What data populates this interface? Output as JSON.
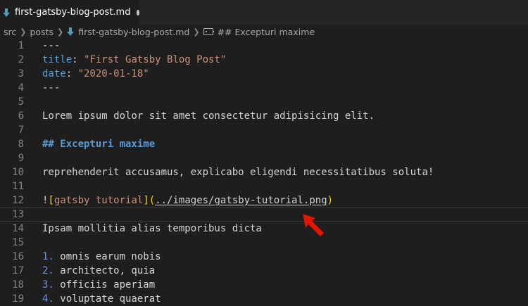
{
  "tab": {
    "icon": "markdown-file-icon",
    "label": "first-gatsby-blog-post.md"
  },
  "breadcrumb": {
    "items": [
      "src",
      "posts",
      "first-gatsby-blog-post.md",
      "## Excepturi maxime"
    ]
  },
  "editor": {
    "lines": [
      {
        "n": "1",
        "parts": [
          {
            "t": "---",
            "c": ""
          }
        ]
      },
      {
        "n": "2",
        "parts": [
          {
            "t": "title",
            "c": "tok-key"
          },
          {
            "t": ": ",
            "c": ""
          },
          {
            "t": "\"First Gatsby Blog Post\"",
            "c": "tok-str"
          }
        ]
      },
      {
        "n": "3",
        "parts": [
          {
            "t": "date",
            "c": "tok-key"
          },
          {
            "t": ": ",
            "c": ""
          },
          {
            "t": "\"2020-01-18\"",
            "c": "tok-str"
          }
        ]
      },
      {
        "n": "4",
        "parts": [
          {
            "t": "---",
            "c": ""
          }
        ]
      },
      {
        "n": "5",
        "parts": []
      },
      {
        "n": "6",
        "parts": [
          {
            "t": "Lorem ipsum dolor sit amet consectetur adipisicing elit.",
            "c": ""
          }
        ]
      },
      {
        "n": "7",
        "parts": []
      },
      {
        "n": "8",
        "parts": [
          {
            "t": "## Excepturi maxime",
            "c": "tok-head"
          }
        ]
      },
      {
        "n": "9",
        "parts": []
      },
      {
        "n": "10",
        "parts": [
          {
            "t": "reprehenderit accusamus, explicabo eligendi necessitatibus soluta!",
            "c": ""
          }
        ]
      },
      {
        "n": "11",
        "parts": []
      },
      {
        "n": "12",
        "parts": [
          {
            "t": "!",
            "c": ""
          },
          {
            "t": "[",
            "c": "tok-bracket"
          },
          {
            "t": "gatsby tutorial",
            "c": "tok-link-text"
          },
          {
            "t": "]",
            "c": "tok-bracket"
          },
          {
            "t": "(",
            "c": "tok-bracket"
          },
          {
            "t": "../images/gatsby-tutorial.png",
            "c": "tok-url"
          },
          {
            "t": ")",
            "c": "tok-bracket"
          }
        ]
      },
      {
        "n": "13",
        "parts": [],
        "current": true
      },
      {
        "n": "14",
        "parts": [
          {
            "t": "Ipsam mollitia alias temporibus dicta",
            "c": ""
          }
        ]
      },
      {
        "n": "15",
        "parts": []
      },
      {
        "n": "16",
        "parts": [
          {
            "t": "1.",
            "c": "tok-list"
          },
          {
            "t": " omnis earum nobis",
            "c": ""
          }
        ]
      },
      {
        "n": "17",
        "parts": [
          {
            "t": "2.",
            "c": "tok-list"
          },
          {
            "t": " architecto, quia",
            "c": ""
          }
        ]
      },
      {
        "n": "18",
        "parts": [
          {
            "t": "3.",
            "c": "tok-list"
          },
          {
            "t": " officiis aperiam",
            "c": ""
          }
        ]
      },
      {
        "n": "19",
        "parts": [
          {
            "t": "4.",
            "c": "tok-list"
          },
          {
            "t": " voluptate quaerat",
            "c": ""
          }
        ]
      }
    ]
  },
  "annotation": {
    "icon": "red-arrow-icon",
    "color": "#e51400"
  }
}
